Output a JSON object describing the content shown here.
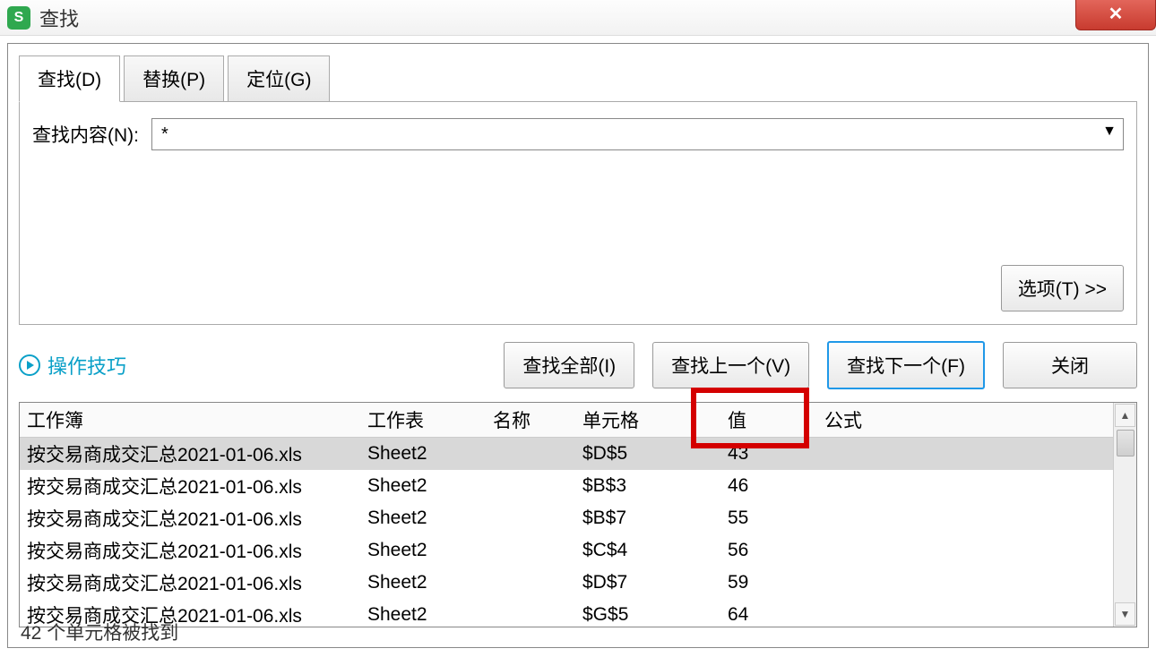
{
  "window": {
    "title": "查找",
    "close_glyph": "✕"
  },
  "tabs": {
    "find": "查找(D)",
    "replace": "替换(P)",
    "goto": "定位(G)"
  },
  "find": {
    "label": "查找内容(N):",
    "value": "*"
  },
  "options_btn": "选项(T) >>",
  "tips_label": "操作技巧",
  "buttons": {
    "find_all": "查找全部(I)",
    "find_prev": "查找上一个(V)",
    "find_next": "查找下一个(F)",
    "close": "关闭"
  },
  "headers": {
    "workbook": "工作簿",
    "worksheet": "工作表",
    "name": "名称",
    "cell": "单元格",
    "value": "值",
    "formula": "公式"
  },
  "rows": [
    {
      "wb": "按交易商成交汇总2021-01-06.xls",
      "ws": "Sheet2",
      "nm": "",
      "cell": "$D$5",
      "val": "43",
      "fx": "",
      "selected": true
    },
    {
      "wb": "按交易商成交汇总2021-01-06.xls",
      "ws": "Sheet2",
      "nm": "",
      "cell": "$B$3",
      "val": "46",
      "fx": ""
    },
    {
      "wb": "按交易商成交汇总2021-01-06.xls",
      "ws": "Sheet2",
      "nm": "",
      "cell": "$B$7",
      "val": "55",
      "fx": ""
    },
    {
      "wb": "按交易商成交汇总2021-01-06.xls",
      "ws": "Sheet2",
      "nm": "",
      "cell": "$C$4",
      "val": "56",
      "fx": ""
    },
    {
      "wb": "按交易商成交汇总2021-01-06.xls",
      "ws": "Sheet2",
      "nm": "",
      "cell": "$D$7",
      "val": "59",
      "fx": ""
    },
    {
      "wb": "按交易商成交汇总2021-01-06.xls",
      "ws": "Sheet2",
      "nm": "",
      "cell": "$G$5",
      "val": "64",
      "fx": ""
    }
  ],
  "status": "42 个单元格被找到"
}
